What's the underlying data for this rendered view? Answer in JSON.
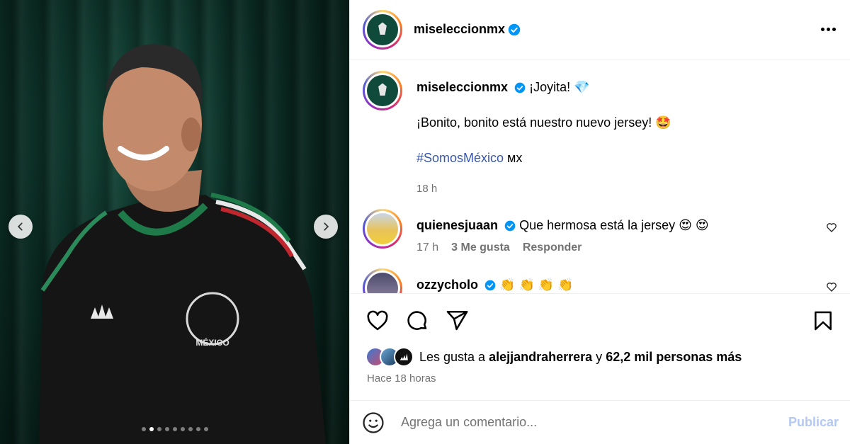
{
  "account": {
    "username": "miseleccionmx",
    "verified": true
  },
  "caption": {
    "username": "miseleccionmx",
    "line1": "¡Joyita! 💎",
    "line2": "¡Bonito, bonito está nuestro nuevo jersey! 🤩",
    "hashtag": "#SomosMéxico",
    "hashtag_suffix": " мх",
    "time": "18 h"
  },
  "comments": [
    {
      "username": "quienesjuaan",
      "verified": true,
      "text": "Que hermosa está la jersey 😍 😍",
      "time": "17 h",
      "likes": "3 Me gusta",
      "reply": "Responder"
    },
    {
      "username": "ozzycholo",
      "verified": true,
      "text": "👏 👏 👏 👏"
    }
  ],
  "likes": {
    "prefix": "Les gusta a ",
    "user": "alejjandraherrera",
    "connector": " y ",
    "count": "62,2 mil personas más"
  },
  "posted_ago": "Hace 18 horas",
  "add_comment": {
    "placeholder": "Agrega un comentario...",
    "publish_label": "Publicar"
  },
  "carousel": {
    "total": 9,
    "active_index": 1
  },
  "colors": {
    "verified": "#0095f6",
    "link": "#3a56a8",
    "secondary_text": "#737373"
  }
}
